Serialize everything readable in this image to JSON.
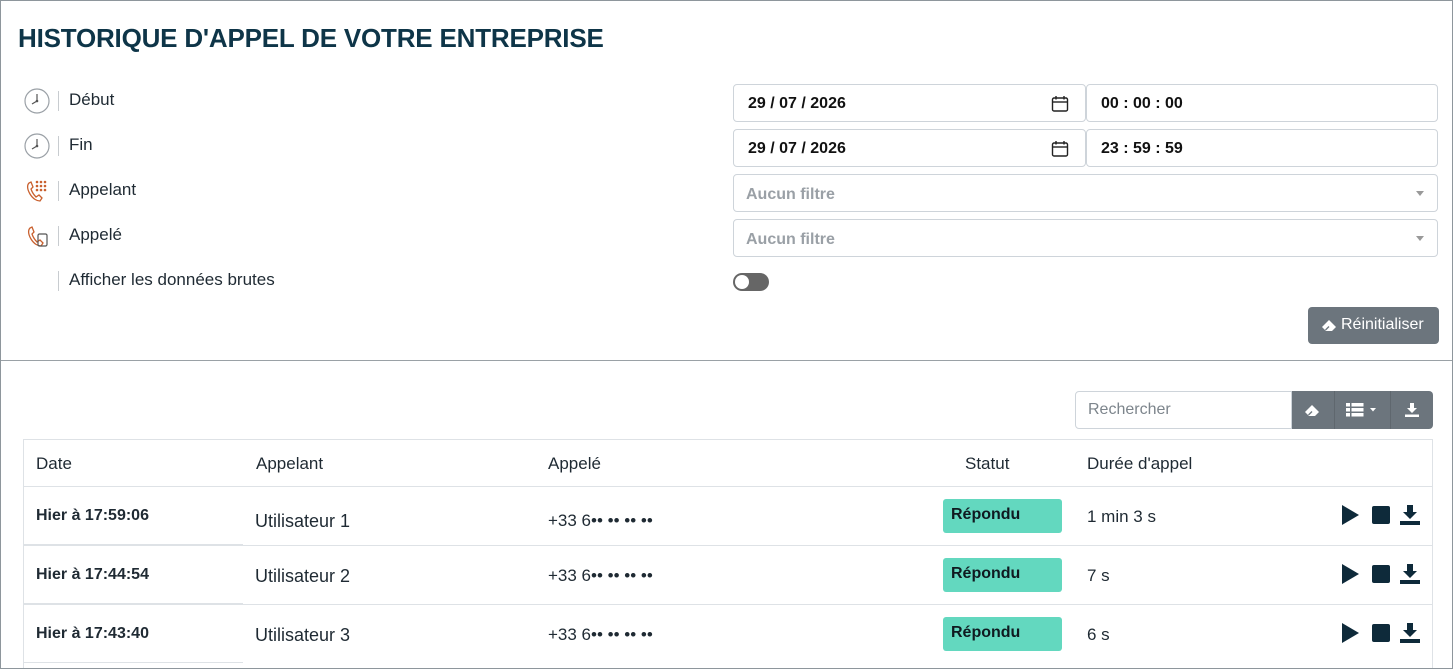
{
  "page": {
    "title": "HISTORIQUE D'APPEL DE VOTRE ENTREPRISE"
  },
  "filters": {
    "start": {
      "label": "Début",
      "icon": "clock-icon",
      "date": "29 / 07 / 2026",
      "time": "00 : 00 : 00"
    },
    "end": {
      "label": "Fin",
      "icon": "clock-icon",
      "date": "29 / 07 / 2026",
      "time": "23 : 59 : 59"
    },
    "caller": {
      "label": "Appelant",
      "icon": "dialpad-phone-icon",
      "placeholder": "Aucun filtre"
    },
    "callee": {
      "label": "Appelé",
      "icon": "incoming-phone-icon",
      "placeholder": "Aucun filtre"
    },
    "raw": {
      "label": "Afficher les données brutes",
      "enabled": false
    },
    "reset_label": "Réinitialiser"
  },
  "toolbar": {
    "search_placeholder": "Rechercher",
    "buttons": [
      "eraser-icon",
      "columns-icon",
      "download-icon"
    ]
  },
  "table": {
    "headers": {
      "date": "Date",
      "caller": "Appelant",
      "callee": "Appelé",
      "status": "Statut",
      "duration": "Durée d'appel"
    },
    "rows": [
      {
        "date": "Hier à 17:59:06",
        "caller": "Utilisateur 1",
        "callee": "+33 6•• •• •• ••",
        "status": "Répondu",
        "duration": "1 min 3 s"
      },
      {
        "date": "Hier à 17:44:54",
        "caller": "Utilisateur 2",
        "callee": "+33 6•• •• •• ••",
        "status": "Répondu",
        "duration": "7 s"
      },
      {
        "date": "Hier à 17:43:40",
        "caller": "Utilisateur 3",
        "callee": "+33 6•• •• •• ••",
        "status": "Répondu",
        "duration": "6 s"
      }
    ]
  },
  "colors": {
    "title": "#0e3548",
    "status_answered": "#63d8bf",
    "button_gray": "#6c757d"
  }
}
